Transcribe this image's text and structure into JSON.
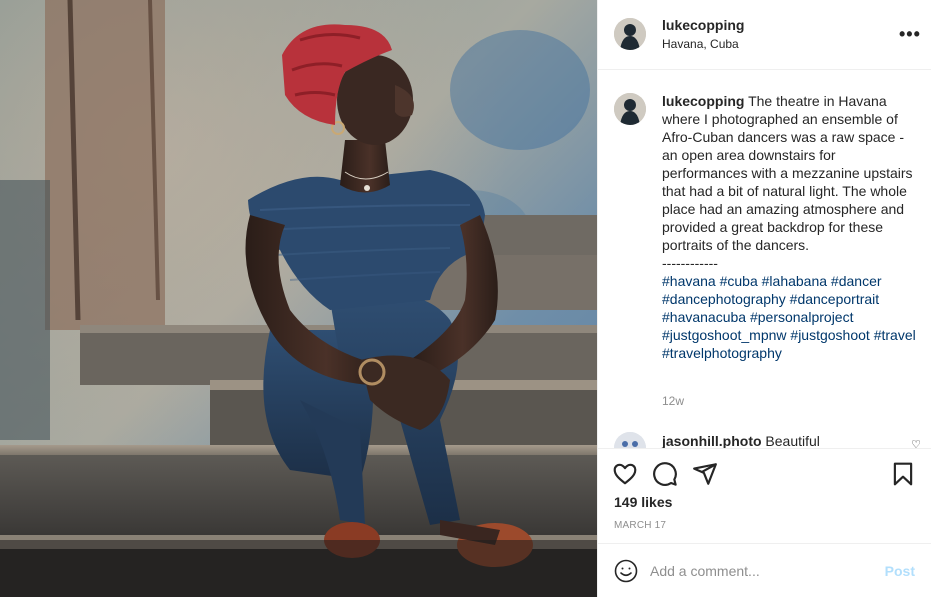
{
  "post": {
    "username": "lukecopping",
    "location": "Havana, Cuba",
    "more_options": "•••",
    "caption_text": " The theatre in Havana where I photographed an ensemble of Afro-Cuban dancers was a raw space - an open area downstairs for performances with a mezzanine upstairs that had a bit of natural light. The whole place had an amazing atmosphere and provided a great backdrop for these portraits of the dancers.",
    "separator": "------------",
    "hashtags": "#havana #cuba #lahabana #dancer #dancephotography #danceportrait #havanacuba #personalproject #justgoshoot_mpnw #justgoshoot #travel #travelphotography",
    "time_ago": "12w"
  },
  "comment": {
    "username": "jasonhill.photo",
    "text": " Beautiful"
  },
  "actions": {
    "icons": [
      "heart-icon",
      "comment-icon",
      "share-icon",
      "bookmark-icon"
    ]
  },
  "stats": {
    "likes": "149 likes",
    "date": "MARCH 17"
  },
  "add_comment": {
    "placeholder": "Add a comment...",
    "post_label": "Post",
    "post_color": "#b2dffc"
  },
  "colors": {
    "headwrap": "#b8323b",
    "link": "#00376b",
    "border": "#efefef"
  }
}
